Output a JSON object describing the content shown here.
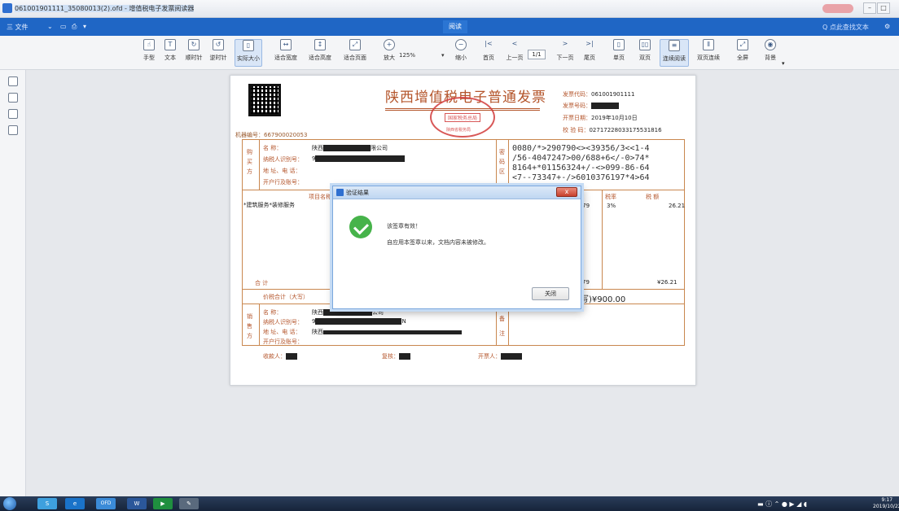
{
  "window": {
    "title": "061001901111_35080013(2).ofd - 增值税电子发票阅读器"
  },
  "menubar": {
    "file": "三 文件",
    "center_tab": "阅读",
    "search": "Q 点此查找文本"
  },
  "toolbar": {
    "items": [
      {
        "label": "手型",
        "icon": "hand-icon"
      },
      {
        "label": "文本",
        "icon": "text-select-icon"
      },
      {
        "label": "顺时针",
        "icon": "rotate-cw-icon"
      },
      {
        "label": "逆时针",
        "icon": "rotate-ccw-icon"
      },
      {
        "label": "实际大小",
        "icon": "actual-size-icon"
      },
      {
        "label": "适合宽度",
        "icon": "fit-width-icon"
      },
      {
        "label": "适合高度",
        "icon": "fit-height-icon"
      },
      {
        "label": "适合页面",
        "icon": "fit-page-icon"
      },
      {
        "label": "放大",
        "icon": "zoom-in-icon"
      },
      {
        "label": "缩小",
        "icon": "zoom-out-icon"
      },
      {
        "label": "首页",
        "icon": "first-page-icon"
      },
      {
        "label": "上一页",
        "icon": "prev-page-icon"
      },
      {
        "label": "下一页",
        "icon": "next-page-icon"
      },
      {
        "label": "尾页",
        "icon": "last-page-icon"
      },
      {
        "label": "单页",
        "icon": "single-page-icon"
      },
      {
        "label": "双页",
        "icon": "double-page-icon"
      },
      {
        "label": "连续阅读",
        "icon": "continuous-icon"
      },
      {
        "label": "双页连续",
        "icon": "double-continuous-icon"
      },
      {
        "label": "全屏",
        "icon": "fullscreen-icon"
      },
      {
        "label": "背景",
        "icon": "eye-icon"
      }
    ],
    "zoom": "125%",
    "page": "1/1"
  },
  "invoice": {
    "title": "陕西增值税电子普通发票",
    "machine_no": "机器编号：667900020053",
    "code_label": "发票代码：",
    "code": "061001901111",
    "number_label": "发票号码：",
    "date_label": "开票日期：",
    "date": "2019年10月10日",
    "check_label": "校 验 码：",
    "check": "02717228033175531816",
    "seal_inner": "国家税务总局",
    "seal_bottom": "陕西省税务局",
    "buyer_side": "购买方",
    "buyer_name_label": "名      称：",
    "buyer_name_prefix": "陕西",
    "buyer_name_suffix": "限公司",
    "buyer_tax_label": "纳税人识别号：",
    "buyer_tax_prefix": "9",
    "buyer_addr_label": "地 址、电 话：",
    "buyer_bank_label": "开户行及账号：",
    "cipher_side": "密码区",
    "cipher": "0080/*>290790<><39356/3<<1-4\n/56-4047247>00/688+6</-0>74*\n8164+*01156324+/-<>099-86-64\n<7--73347+-/>6010376197*4>64",
    "col_item": "项目名称",
    "col_rate": "税率",
    "col_tax": "税  额",
    "item_name": "*建筑服务*装修服务",
    "item_amount_tail": ".79",
    "item_rate": "3%",
    "item_tax": "26.21",
    "total_label": "合      计",
    "total_amount_tail": "79",
    "total_tax": "¥26.21",
    "grand_label": "价税合计（大写）",
    "grand_small": "写)¥900.00",
    "seller_side": "销售方",
    "seller_name_label": "名      称：",
    "seller_name_prefix": "陕西",
    "seller_name_suffix": "公司",
    "seller_tax_label": "纳税人识别号：",
    "seller_tax_prefix": "9",
    "seller_tax_suffix": "N",
    "seller_addr_label": "地 址、电 话：",
    "seller_addr_prefix": "陕西",
    "seller_bank_label": "开户行及账号：",
    "remark_side": "备注",
    "payee_label": "收款人：",
    "reviewer_label": "复核：",
    "drawer_label": "开票人："
  },
  "dialog": {
    "title": "验证结果",
    "close_glyph": "x",
    "line1": "该签章有效！",
    "line2": "自应用本签章以来，文档内容未被修改。",
    "button": "关闭"
  },
  "taskbar": {
    "time": "9:17",
    "date": "2019/10/22",
    "ofd_label": "OFD"
  }
}
